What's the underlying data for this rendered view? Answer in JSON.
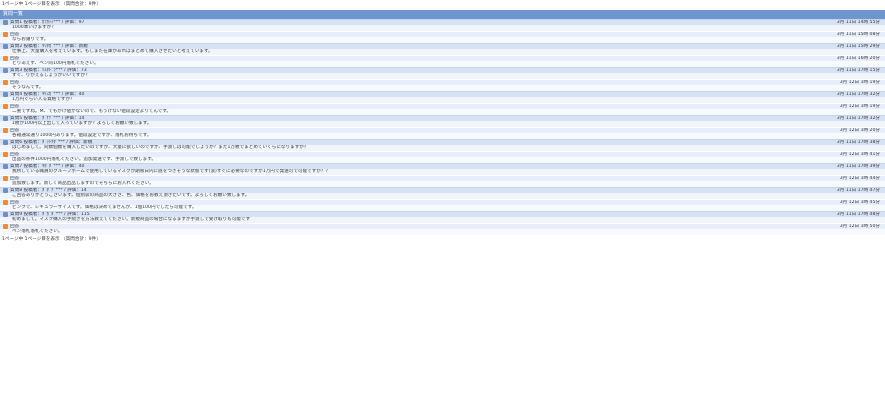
{
  "pager_top": "1ページ中 1ページ目を表示 （質問合計：9件）",
  "pager_bottom": "1ページ中 1ページ目を表示 （質問合計：9件）",
  "list_title": "質問一覧",
  "colors": {
    "header": "#6f95cf",
    "question_row": "#d7e3f5",
    "answer_row": "#e7eef9",
    "question_icon": "#6b8fcc",
    "answer_icon": "#f08a2c"
  },
  "icons": {
    "question": "question-icon",
    "answer": "answer-icon"
  },
  "items": [
    {
      "q_head": "質問1 投稿者：ｶﾗｶｯｯ*** / 評価：97",
      "q_date": "3月 11日 14時 55分",
      "q_body": "1000本いけますか？",
      "a_head": "回答",
      "a_date": "3月 11日 15時 08分",
      "a_body": "ならお譲りです。"
    },
    {
      "q_head": "質問2 投稿者：ｷﾜﾀｶﾞ*** / 評価：新規",
      "q_date": "3月 11日 15時 29分",
      "q_body": "仕事上、大量購入を考えています。もしまだ在庫があればまとめて購入させたいと考えています。",
      "a_head": "回答",
      "a_date": "3月 11日 16時 20分",
      "a_body": "とりあえず、ペン同100円落札ください。"
    },
    {
      "q_head": "質問3 投稿者：ﾘｽﾀﾄﾞﾗ*** / 評価：73",
      "q_date": "3月 11日 17時 15分",
      "q_body": "すぐ、りかえるしょうがいいですか？",
      "a_head": "回答",
      "a_date": "3月 12日 1時 19分",
      "a_body": "そうなんです。"
    },
    {
      "q_head": "質問4 投稿者：ｷﾘｽｶﾞ*** / 評価：40",
      "q_date": "3月 11日 17時 32分",
      "q_body": "1万円ぐらい入る資格ですか？",
      "a_head": "回答",
      "a_date": "3月 12日 1時 19分",
      "a_body": "二重ですね。M、でもかけ値がないので、もうけない値段設定よりてんです。"
    },
    {
      "q_head": "質問5 投稿者：ﾀﾞﾅﾃﾞ*** / 評価：14",
      "q_date": "3月 11日 17時 32分",
      "q_body": "1枚が100円以上出して入っていますか？よろしくお願い致します。",
      "a_head": "回答",
      "a_date": "3月 12日 1時 20分",
      "a_body": "各箱通常通り1000円あります。値段設定ですが、落札お待ちです。"
    },
    {
      "q_head": "質問6 投稿者：ﾀﾞｯﾄｸﾀﾞ*** / 評価：新規",
      "q_date": "3月 11日 17時 38分",
      "q_body": "はじめまして。同数個数を購入したいのですが、大量に欲しいのですが、手渡しは可能でしょうか？また1万枚でまとめていくらになりますか？",
      "a_head": "回答",
      "a_date": "3月 12日 1時 41分",
      "a_body": "出品の条件1000円落札ください。追加発送です、手渡しで致します。"
    },
    {
      "q_head": "質問7 投稿者：ｷﾎﾞﾀﾞ*** / 評価：40",
      "q_date": "3月 11日 17時 39分",
      "q_body": "我所している職員のグループホームで使用しているマスクが期限日内に底をつきそうな状態です(涙)すぐに必要なのですが1万円で発送可で可能ですか？？",
      "a_head": "回答",
      "a_date": "3月 12日 1時 44分",
      "a_body": "追加致します。新しく商品出品しますのでそちらにお入れください。"
    },
    {
      "q_head": "質問8 投稿者：ﾀﾞﾀﾞﾅﾞ*** / 評価：14",
      "q_date": "3月 11日 17時 47分",
      "q_body": "ご回答ありがとうございます。個別袋の商品の大きさ、色、価格をお教え頂きたいです。よろしくお願い致します。",
      "a_head": "回答",
      "a_date": "3月 12日 1時 45分",
      "a_body": "ピンクで、レギュラーサイズです。価格は決めてませんが、1個100円でしたら可能です。"
    },
    {
      "q_head": "質問9 投稿者：ﾀﾞｶﾞﾀﾞ*** / 評価：115",
      "q_date": "3月 11日 17時 48分",
      "q_body": "初めまして。マスク購入の手続きを方法教えてください。新規商品の場合になるますが手渡しで受け取りも可能です",
      "a_head": "回答",
      "a_date": "3月 12日 1時 50分",
      "a_body": "ペン落札落札ください。"
    }
  ]
}
